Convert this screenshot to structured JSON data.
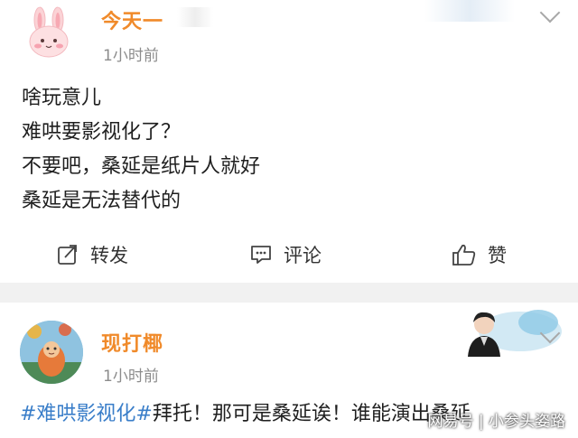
{
  "post1": {
    "username": "今天一",
    "time": "1小时前",
    "lines": [
      "啥玩意儿",
      "难哄要影视化了？",
      "不要吧，桑延是纸片人就好",
      "桑延是无法替代的"
    ],
    "actions": {
      "repost": "转发",
      "comment": "评论",
      "like": "赞"
    }
  },
  "post2": {
    "username": "现打椰",
    "time": "1小时前",
    "hashtag": "#难哄影视化#",
    "text": "拜托！那可是桑延诶！谁能演出桑延"
  },
  "watermark": "网易号 | 小参头姿路",
  "colors": {
    "username": "#f08a2a",
    "hashtag": "#3a7ec9",
    "separator": "#f1f1f1"
  },
  "icons": [
    "bunny-avatar-icon",
    "chevron-down-icon",
    "repost-icon",
    "comment-icon",
    "like-icon"
  ]
}
